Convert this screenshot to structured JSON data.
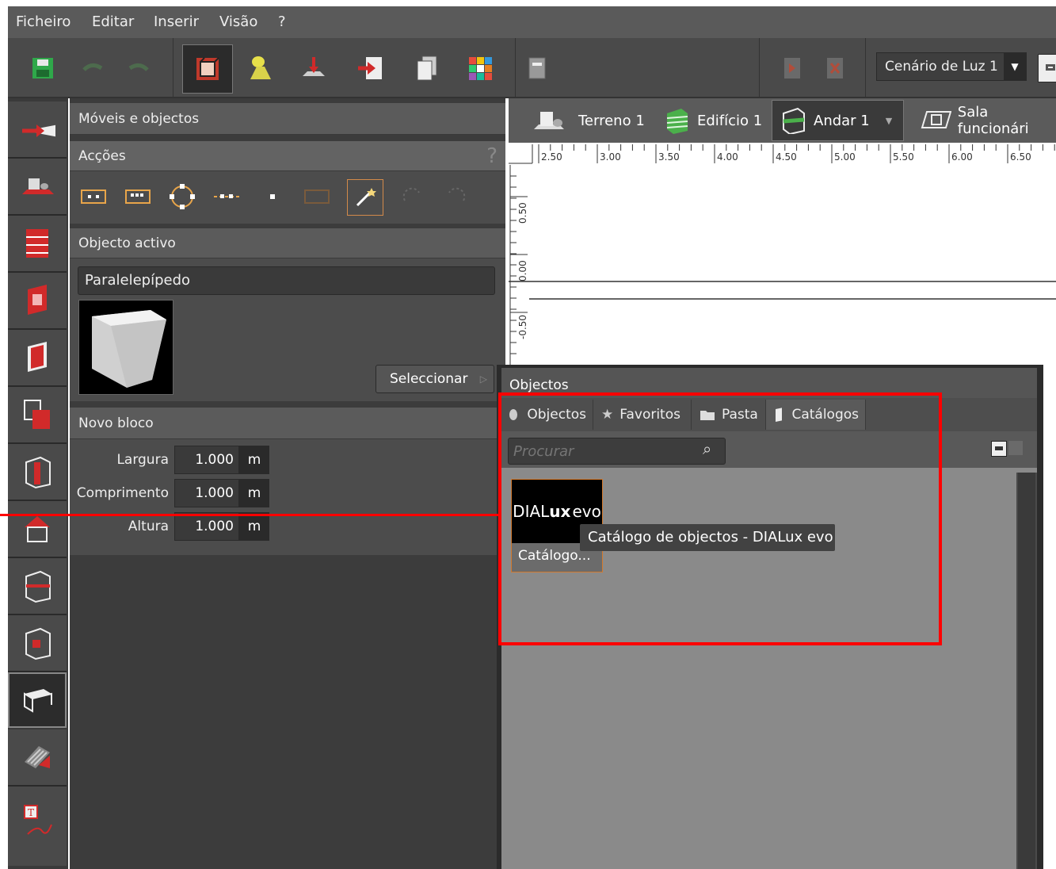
{
  "menu": {
    "items": [
      {
        "label": "Ficheiro"
      },
      {
        "label": "Editar"
      },
      {
        "label": "Inserir"
      },
      {
        "label": "Visão"
      },
      {
        "label": "?"
      }
    ]
  },
  "toolbar": {
    "scene_select": "Cenário de Luz 1"
  },
  "side_panel": {
    "title": "Móveis e objectos",
    "actions_header": "Acções",
    "help": "?",
    "active_object_header": "Objecto activo",
    "active_object_name": "Paralelepípedo",
    "select_button": "Seleccionar",
    "new_block_header": "Novo bloco",
    "dimensions": [
      {
        "label": "Largura",
        "value": "1.000",
        "unit": "m"
      },
      {
        "label": "Comprimento",
        "value": "1.000",
        "unit": "m"
      },
      {
        "label": "Altura",
        "value": "1.000",
        "unit": "m"
      }
    ]
  },
  "view_tabs": [
    {
      "label": "Terreno 1"
    },
    {
      "label": "Edifício 1"
    },
    {
      "label": "Andar 1"
    },
    {
      "label": "Sala funcionári"
    }
  ],
  "ruler": {
    "horizontal": [
      "2.50",
      "3.00",
      "3.50",
      "4.00",
      "4.50",
      "5.00",
      "5.50",
      "6.00",
      "6.50"
    ],
    "vertical": [
      "0.50",
      "0.00",
      "-0.50"
    ]
  },
  "objects_panel": {
    "title": "Objectos",
    "tabs": [
      {
        "label": "Objectos"
      },
      {
        "label": "Favoritos"
      },
      {
        "label": "Pasta"
      },
      {
        "label": "Catálogos"
      }
    ],
    "search_placeholder": "Procurar",
    "catalog": {
      "logo_prefix": "DIAL",
      "logo_bold": "ux",
      "logo_suffix": "evo",
      "label": "Catálogo...",
      "tooltip": "Catálogo de objectos - DIALux evo"
    }
  },
  "colors": {
    "accent": "#d12a2a",
    "annotation": "#ff0000",
    "card_border": "#d37a2e"
  }
}
